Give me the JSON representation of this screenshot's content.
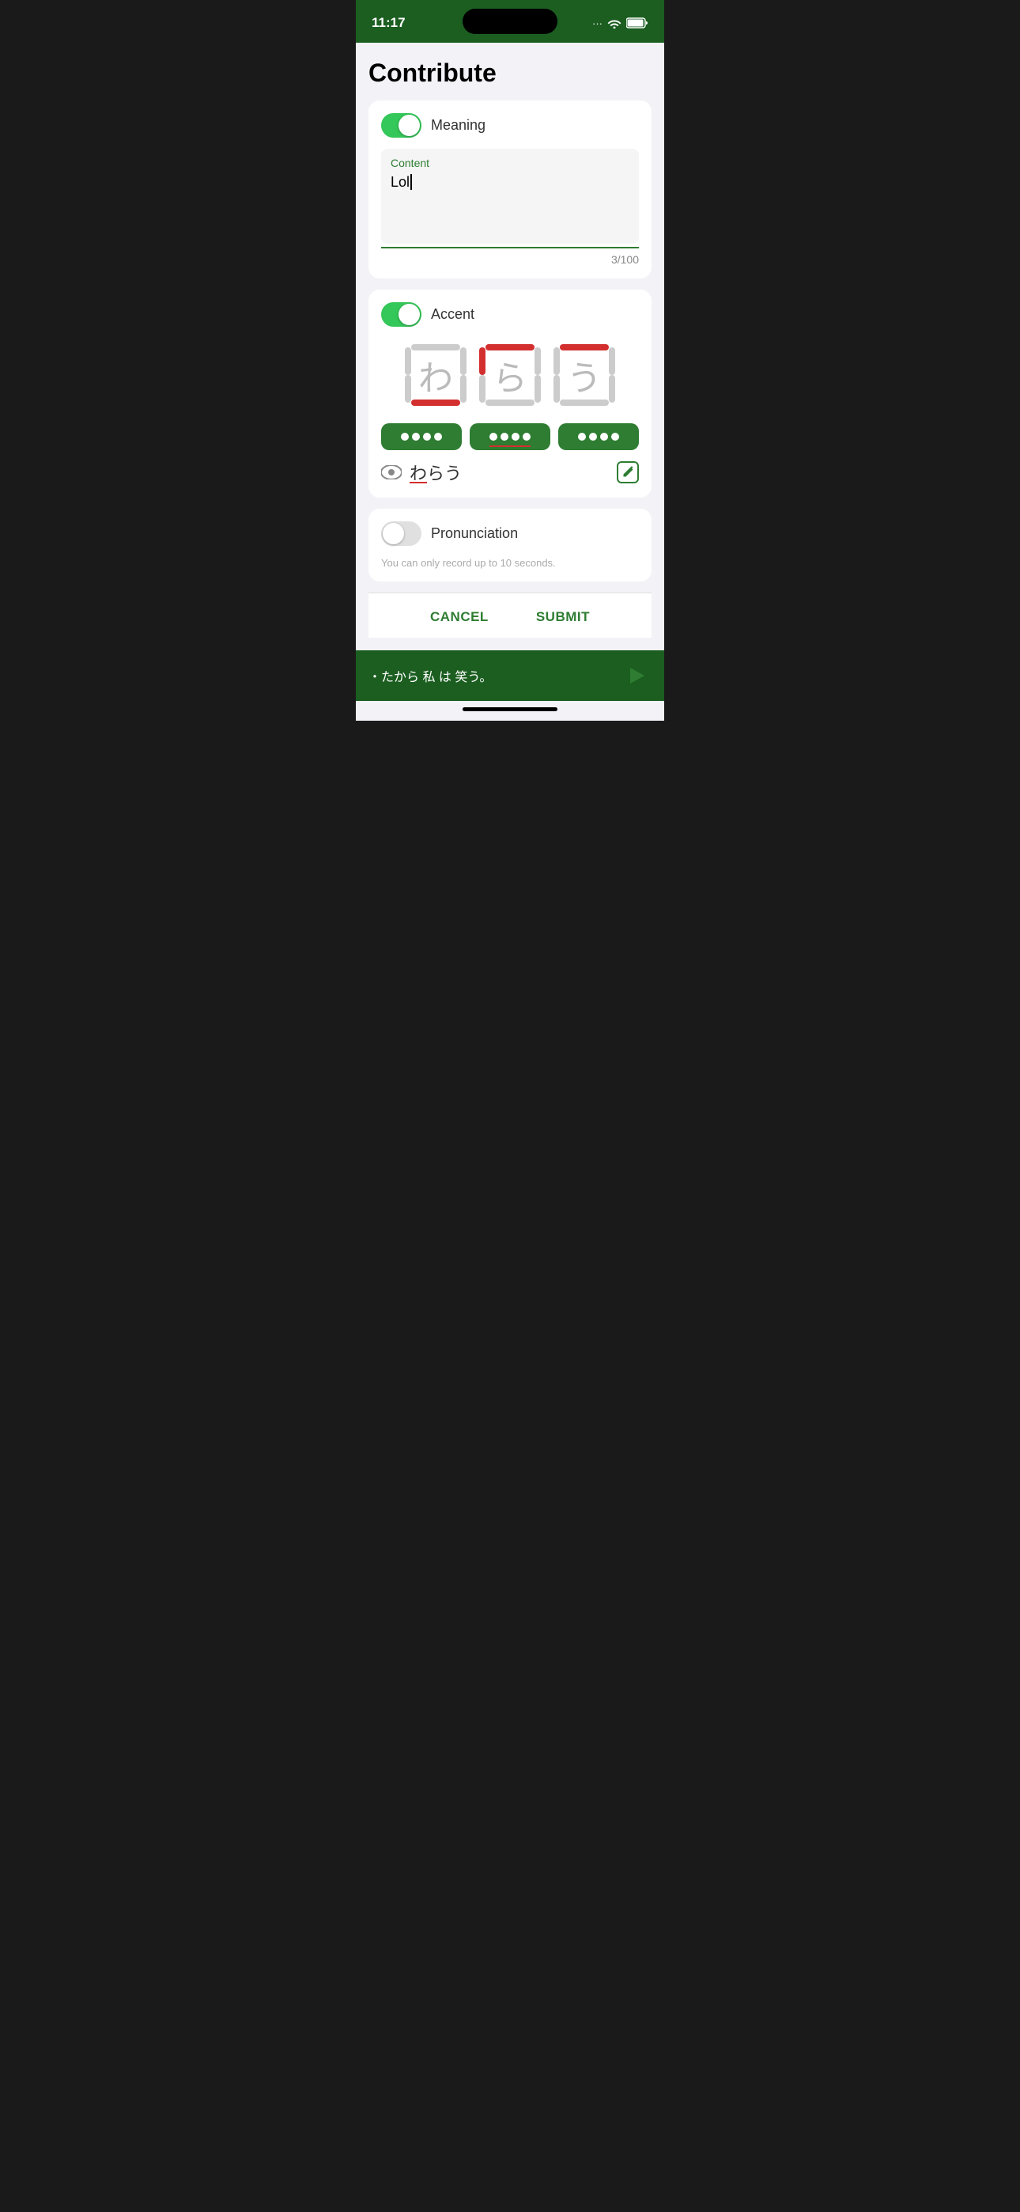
{
  "statusBar": {
    "time": "11:17",
    "wifi": "wifi",
    "battery": "battery"
  },
  "page": {
    "title": "Contribute"
  },
  "meaningSection": {
    "toggleLabel": "Meaning",
    "toggleOn": true,
    "fieldLabel": "Content",
    "fieldValue": "Lol",
    "charCount": "3/100"
  },
  "accentSection": {
    "toggleLabel": "Accent",
    "toggleOn": true,
    "kana": [
      "わ",
      "ら",
      "う"
    ],
    "previewKana": "わらう",
    "previewUnderline": "わ",
    "buttons": [
      {
        "dots": 4,
        "hasUnderline": false
      },
      {
        "dots": 4,
        "hasUnderline": true
      },
      {
        "dots": 4,
        "hasUnderline": false
      }
    ]
  },
  "pronunciationSection": {
    "toggleLabel": "Pronunciation",
    "toggleOn": false,
    "note": "You can only record up to 10 seconds."
  },
  "actions": {
    "cancel": "CANCEL",
    "submit": "SUBMIT"
  },
  "bottomBar": {
    "sentence": "・たから 私 は 笑う。"
  }
}
